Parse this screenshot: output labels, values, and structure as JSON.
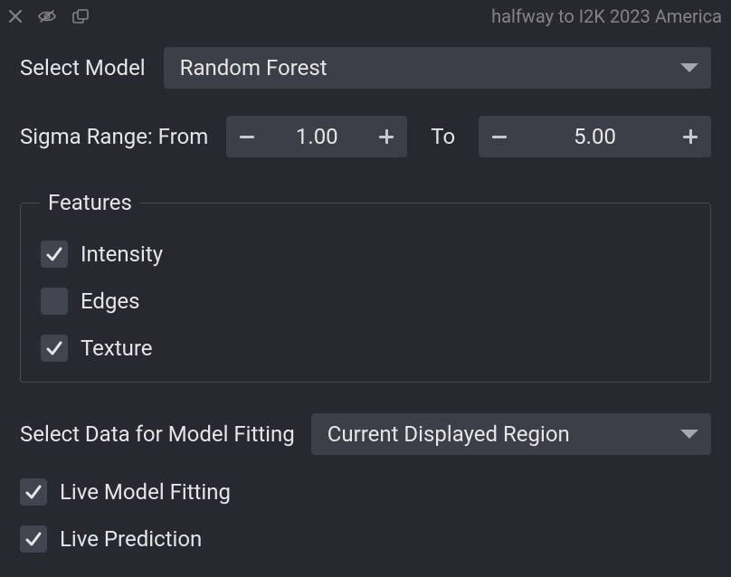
{
  "header": {
    "title": "halfway to I2K 2023 America"
  },
  "model": {
    "label": "Select Model",
    "value": "Random Forest"
  },
  "sigma": {
    "label": "Sigma Range: From",
    "from": "1.00",
    "to_label": "To",
    "to": "5.00"
  },
  "features": {
    "legend": "Features",
    "items": [
      {
        "label": "Intensity",
        "checked": true
      },
      {
        "label": "Edges",
        "checked": false
      },
      {
        "label": "Texture",
        "checked": true
      }
    ]
  },
  "data_select": {
    "label": "Select Data for Model Fitting",
    "value": "Current Displayed Region"
  },
  "live": {
    "fitting": {
      "label": "Live Model Fitting",
      "checked": true
    },
    "prediction": {
      "label": "Live Prediction",
      "checked": true
    }
  }
}
